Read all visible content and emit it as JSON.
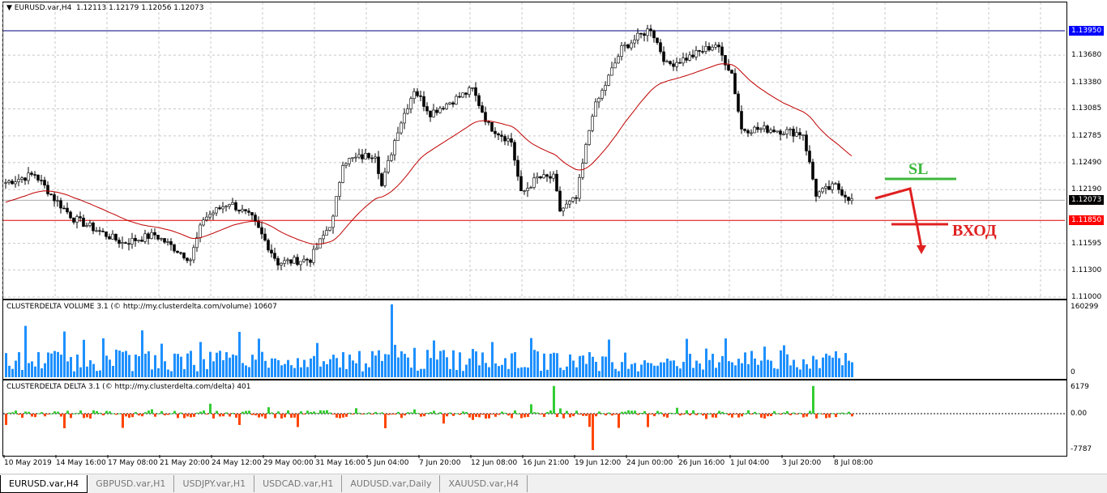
{
  "header": {
    "symbol": "EURUSD.var,H4",
    "ohlc": "1.12113 1.12179 1.12056 1.12073"
  },
  "price_axis": {
    "max": 1.1395,
    "min": 1.11,
    "ticks": [
      "1.13680",
      "1.13380",
      "1.13085",
      "1.12785",
      "1.12490",
      "1.12190",
      "1.11595",
      "1.11300",
      "1.11000"
    ],
    "levels": [
      {
        "label": "1.13950",
        "value": 1.1395,
        "color": "#0000ff"
      },
      {
        "label": "1.12073",
        "value": 1.12073,
        "color": "#000000"
      },
      {
        "label": "1.11850",
        "value": 1.1185,
        "color": "#ff0000"
      }
    ]
  },
  "price_waypoints": [
    [
      0,
      1.1227
    ],
    [
      9,
      1.1236
    ],
    [
      15,
      1.1209
    ],
    [
      21,
      1.1187
    ],
    [
      26,
      1.1178
    ],
    [
      36,
      1.116
    ],
    [
      46,
      1.1169
    ],
    [
      57,
      1.1142
    ],
    [
      61,
      1.1187
    ],
    [
      69,
      1.1205
    ],
    [
      76,
      1.1187
    ],
    [
      84,
      1.1138
    ],
    [
      94,
      1.1142
    ],
    [
      101,
      1.1187
    ],
    [
      104,
      1.125
    ],
    [
      114,
      1.1259
    ],
    [
      116,
      1.1223
    ],
    [
      121,
      1.1286
    ],
    [
      126,
      1.133
    ],
    [
      131,
      1.1304
    ],
    [
      144,
      1.133
    ],
    [
      149,
      1.129
    ],
    [
      156,
      1.1272
    ],
    [
      159,
      1.1214
    ],
    [
      164,
      1.1232
    ],
    [
      169,
      1.1232
    ],
    [
      171,
      1.1196
    ],
    [
      176,
      1.1209
    ],
    [
      181,
      1.1304
    ],
    [
      190,
      1.1375
    ],
    [
      199,
      1.1398
    ],
    [
      204,
      1.1357
    ],
    [
      211,
      1.1366
    ],
    [
      219,
      1.138
    ],
    [
      224,
      1.1348
    ],
    [
      227,
      1.1286
    ],
    [
      236,
      1.1286
    ],
    [
      246,
      1.1281
    ],
    [
      250,
      1.1214
    ],
    [
      256,
      1.1223
    ],
    [
      261,
      1.1207
    ]
  ],
  "annotations": {
    "sl": "SL",
    "entry": "ВХОД"
  },
  "volume": {
    "title": "CLUSTERDELTA VOLUME 3.1 (© http://my.clusterdelta.com/volume) 10607",
    "max_label": "160299",
    "min_label": "0",
    "max": 160299,
    "color": "#1e90ff"
  },
  "delta": {
    "title": "CLUSTERDELTA DELTA 3.1 (© http://my.clusterdelta.com/delta) 401",
    "max_label": "6179",
    "zero_label": "0.00",
    "min_label": "-7787",
    "max": 6179,
    "min": -7787,
    "pos_color": "#32cd32",
    "neg_color": "#ff4500"
  },
  "time_axis": [
    "10 May 2019",
    "14 May 16:00",
    "17 May 08:00",
    "21 May 20:00",
    "24 May 12:00",
    "29 May 00:00",
    "31 May 16:00",
    "5 Jun 04:00",
    "7 Jun 20:00",
    "12 Jun 08:00",
    "16 Jun 21:00",
    "19 Jun 12:00",
    "24 Jun 00:00",
    "26 Jun 16:00",
    "1 Jul 04:00",
    "3 Jul 20:00",
    "8 Jul 08:00"
  ],
  "tabs": [
    "EURUSD.var,H4",
    "GBPUSD.var,H1",
    "USDJPY.var,H1",
    "USDCAD.var,H1",
    "AUDUSD.var,Daily",
    "XAUUSD.var,H4"
  ]
}
